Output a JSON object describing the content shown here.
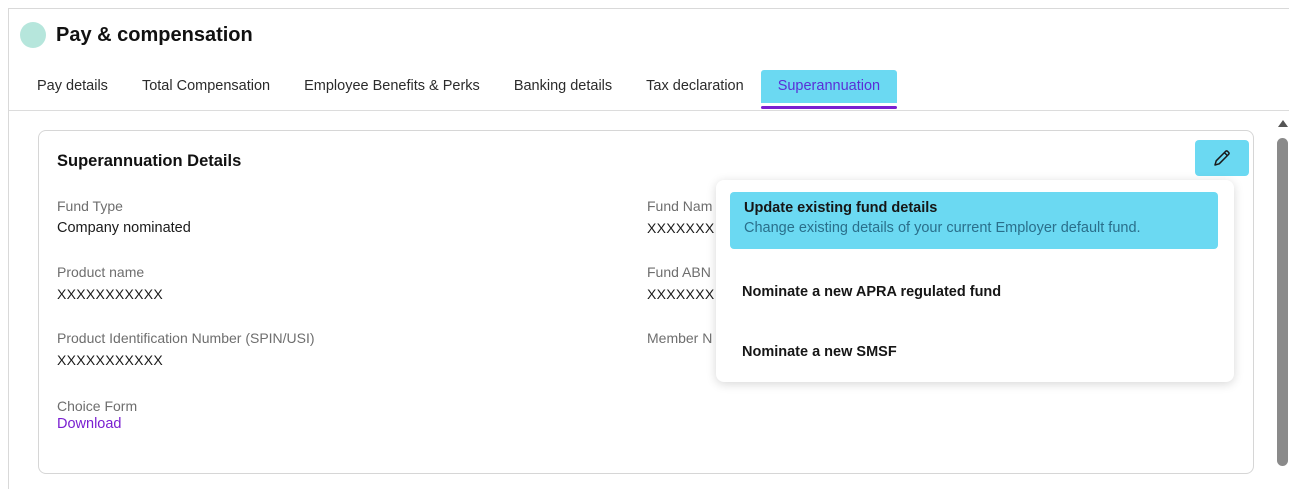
{
  "header": {
    "title": "Pay & compensation"
  },
  "tabs": [
    {
      "label": "Pay details"
    },
    {
      "label": "Total Compensation"
    },
    {
      "label": "Employee Benefits & Perks"
    },
    {
      "label": "Banking details"
    },
    {
      "label": "Tax declaration"
    },
    {
      "label": "Superannuation",
      "active": true
    }
  ],
  "card": {
    "title": "Superannuation Details",
    "fund_type": {
      "label": "Fund Type",
      "value": "Company nominated"
    },
    "product_name": {
      "label": "Product name",
      "value": "XXXXXXXXXXX"
    },
    "spin": {
      "label": "Product Identification Number (SPIN/USI)",
      "value": "XXXXXXXXXXX"
    },
    "choice_form": {
      "label": "Choice Form",
      "link": "Download"
    },
    "fund_name": {
      "label": "Fund Nam",
      "value": "XXXXXXX"
    },
    "fund_abn": {
      "label": "Fund ABN",
      "value": "XXXXXXX"
    },
    "member_no": {
      "label": "Member N"
    }
  },
  "edit_button": {
    "icon": "pencil-icon"
  },
  "menu": {
    "items": [
      {
        "title": "Update existing fund details",
        "description": "Change existing details of your current Employer default fund."
      },
      {
        "title": "Nominate a new APRA regulated fund"
      },
      {
        "title": "Nominate a new SMSF"
      }
    ]
  },
  "colors": {
    "accent": "#6bd9f2",
    "tab_underline": "#7a1fd1",
    "link": "#7a1fd1"
  }
}
